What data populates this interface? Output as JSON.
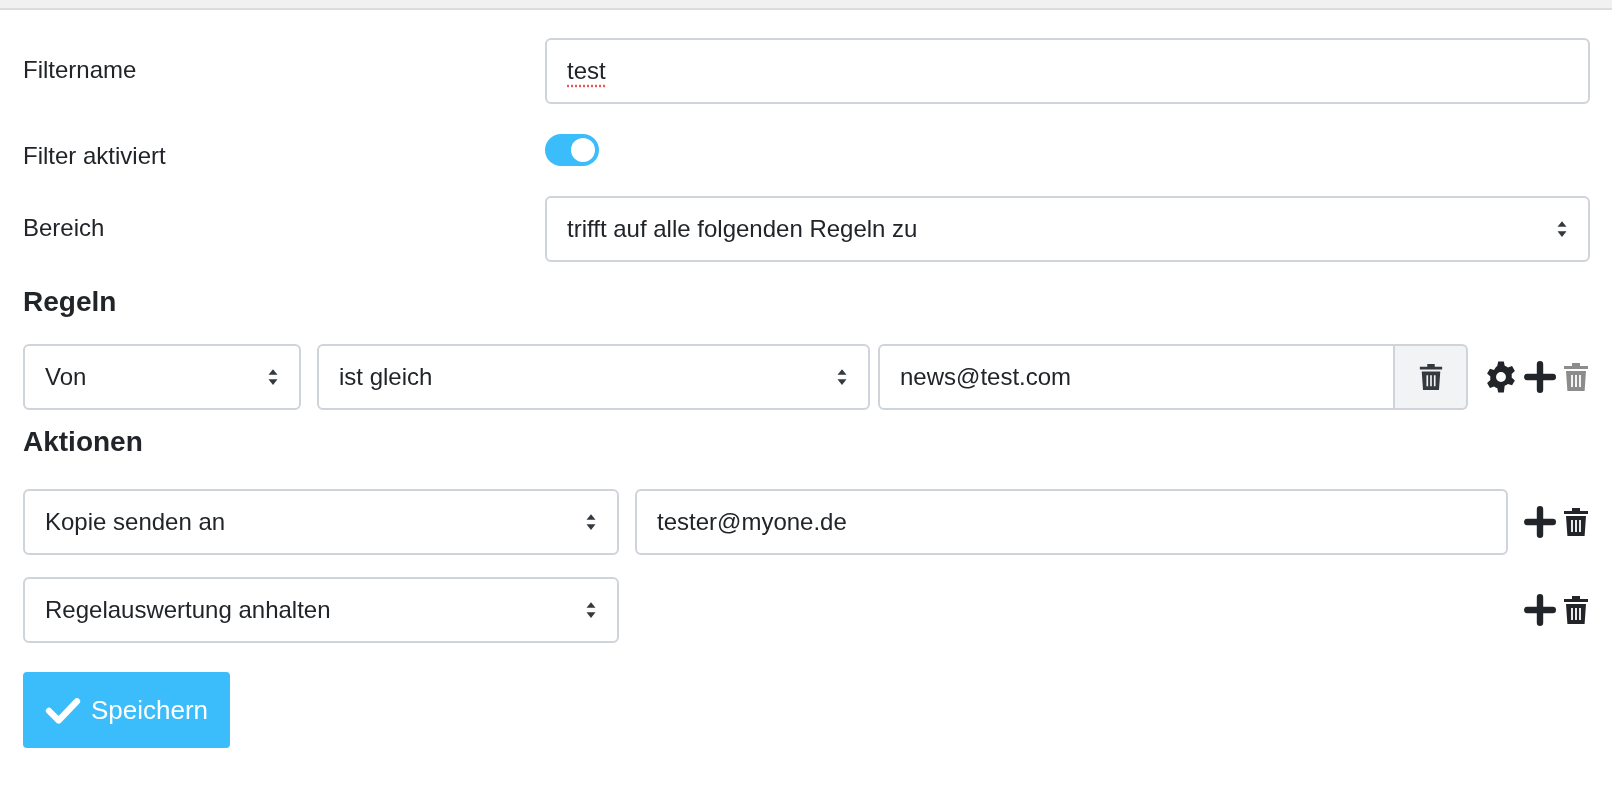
{
  "fields": [
    {
      "kind": "text",
      "label": "Filtername",
      "value": "test"
    },
    {
      "kind": "toggle",
      "label": "Filter aktiviert",
      "on": true
    },
    {
      "kind": "select",
      "label": "Bereich",
      "value": "trifft auf alle folgenden Regeln zu"
    }
  ],
  "rules": {
    "heading": "Regeln",
    "rows": [
      {
        "field": "Von",
        "operator": "ist gleich",
        "value": "news@test.com",
        "delete_disabled": true
      }
    ]
  },
  "actions": {
    "heading": "Aktionen",
    "rows": [
      {
        "kind": "with_value",
        "action": "Kopie senden an",
        "value": "tester@myone.de",
        "delete_disabled": false
      },
      {
        "kind": "plain",
        "action": "Regelauswertung anhalten",
        "delete_disabled": false
      }
    ]
  },
  "save_button": "Speichern"
}
